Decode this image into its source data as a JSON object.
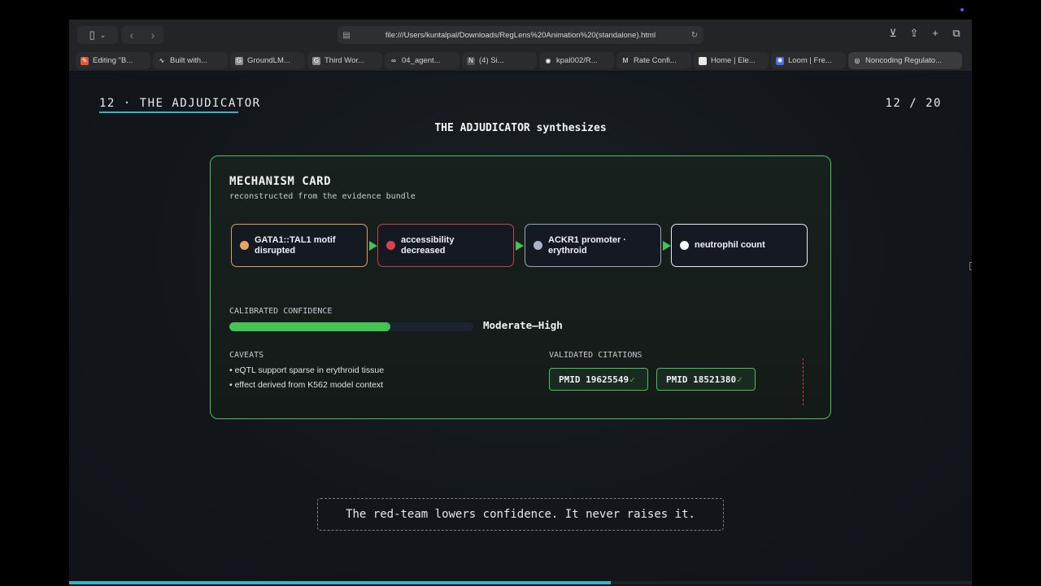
{
  "browser": {
    "url": "file:///Users/kuntalpal/Downloads/RegLens%20Animation%20(standalone).html",
    "tabs": [
      {
        "label": "Editing \"B...",
        "fav_color": "#e05a3a",
        "fav": "✎"
      },
      {
        "label": "Built with...",
        "fav_color": "#2b2c30",
        "fav": "∿"
      },
      {
        "label": "GroundLM...",
        "fav_color": "#8a8d92",
        "fav": "G"
      },
      {
        "label": "Third Wor...",
        "fav_color": "#8a8d92",
        "fav": "G"
      },
      {
        "label": "04_agent...",
        "fav_color": "#2b2c30",
        "fav": "∞"
      },
      {
        "label": "(4) Si...",
        "fav_color": "#555",
        "fav": "N"
      },
      {
        "label": "kpal002/R...",
        "fav_color": "#2b2c30",
        "fav": "◉"
      },
      {
        "label": "Rate Confi...",
        "fav_color": "#2b2c30",
        "fav": "M"
      },
      {
        "label": "Home | Ele...",
        "fav_color": "#e8e8e8",
        "fav": "E"
      },
      {
        "label": "Loom | Fre...",
        "fav_color": "#4a6ee0",
        "fav": "✺"
      },
      {
        "label": "Noncoding Regulato...",
        "fav_color": "#3a3b3f",
        "fav": "◎",
        "active": true
      }
    ]
  },
  "slide": {
    "label": "12 · THE ADJUDICATOR",
    "counter": "12 / 20",
    "headline": "THE ADJUDICATOR synthesizes",
    "progress": 0.6
  },
  "card": {
    "title": "MECHANISM CARD",
    "subtitle": "reconstructed from the evidence bundle",
    "nodes": [
      {
        "line1": "GATA1::TAL1 motif",
        "line2": "disrupted",
        "color": "#e9a65a",
        "border": "#d9a15e"
      },
      {
        "line1": "accessibility",
        "line2": "decreased",
        "color": "#d9434a",
        "border": "#c8424a"
      },
      {
        "line1": "ACKR1 promoter ·",
        "line2": "erythroid",
        "color": "#a9b6c8",
        "border": "#9aa6b6"
      },
      {
        "line1": "neutrophil count",
        "line2": "",
        "color": "#f4f6f8",
        "border": "#e8eaee"
      }
    ],
    "confidence": {
      "label": "CALIBRATED CONFIDENCE",
      "level": 0.66,
      "value": "Moderate–High"
    },
    "caveats": {
      "label": "CAVEATS",
      "items": [
        "• eQTL support sparse in erythroid tissue",
        "• effect derived from K562 model context"
      ]
    },
    "citations": {
      "label": "VALIDATED CITATIONS",
      "items": [
        "PMID 19625549",
        "PMID 18521380"
      ],
      "check": "✓"
    }
  },
  "tagline": "The red-team lowers confidence. It never raises it.",
  "colors": {
    "accent": "#37b3c7",
    "green": "#45c253"
  }
}
